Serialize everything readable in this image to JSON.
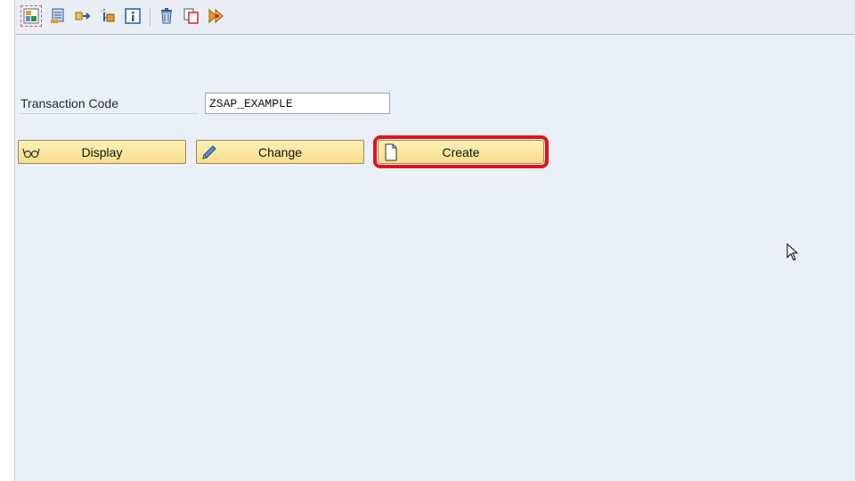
{
  "toolbar": {
    "items": [
      {
        "name": "layout-icon"
      },
      {
        "name": "data-element-icon"
      },
      {
        "name": "transport-icon"
      },
      {
        "name": "hierarchy-icon"
      },
      {
        "name": "info-icon"
      },
      {
        "name": "delete-icon"
      },
      {
        "name": "copy-icon"
      },
      {
        "name": "activate-icon"
      }
    ]
  },
  "form": {
    "transaction_code_label": "Transaction Code",
    "transaction_code_value": "ZSAP_EXAMPLE"
  },
  "buttons": {
    "display_label": "Display",
    "change_label": "Change",
    "create_label": "Create"
  },
  "colors": {
    "background": "#e9f0f7",
    "button_fill": "#f7dd8b",
    "highlight": "#e3121a"
  }
}
